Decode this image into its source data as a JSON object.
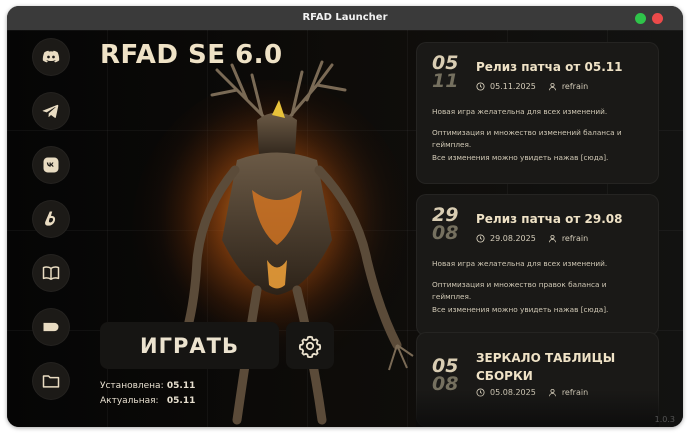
{
  "window": {
    "title": "RFAD Launcher"
  },
  "sidebar": {
    "items": [
      {
        "name": "discord-icon"
      },
      {
        "name": "telegram-icon"
      },
      {
        "name": "vk-icon"
      },
      {
        "name": "boosty-icon"
      },
      {
        "name": "book-icon"
      },
      {
        "name": "tag-icon"
      },
      {
        "name": "folder-icon"
      }
    ]
  },
  "main": {
    "title": "RFAD SE 6.0",
    "play_label": "ИГРАТЬ",
    "installed_label": "Установлена:",
    "installed_value": "05.11",
    "current_label": "Актуальная:",
    "current_value": "05.11"
  },
  "news": [
    {
      "day": "05",
      "month": "11",
      "title": "Релиз патча от 05.11",
      "date": "05.11.2025",
      "author": "refrain",
      "body": [
        "Новая игра желательна для всех изменений.",
        "Оптимизация и множество изменений баланса и геймплея.\nВсе изменения можно увидеть нажав [сюда]."
      ]
    },
    {
      "day": "29",
      "month": "08",
      "title": "Релиз патча от 29.08",
      "date": "29.08.2025",
      "author": "refrain",
      "body": [
        "Новая игра желательна для всех изменений.",
        "Оптимизация и множество правок баланса и геймплея.\nВсе изменения можно увидеть нажав [сюда]."
      ]
    },
    {
      "day": "05",
      "month": "08",
      "title": "ЗЕРКАЛО ТАБЛИЦЫ СБОРКИ",
      "date": "05.08.2025",
      "author": "refrain"
    }
  ],
  "footer": {
    "corner_text": "1.0.3"
  },
  "colors": {
    "accent": "#efe2c6",
    "panel": "#1a1917",
    "background": "#0b0b0b"
  }
}
